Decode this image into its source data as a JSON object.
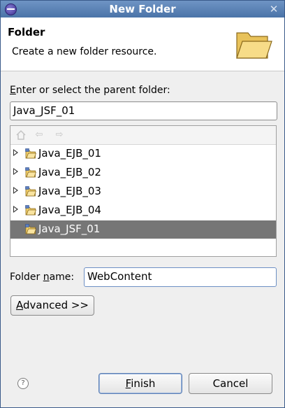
{
  "window": {
    "title": "New Folder"
  },
  "header": {
    "title": "Folder",
    "description": "Create a new folder resource."
  },
  "parent": {
    "label_mnemonic": "E",
    "label_rest": "nter or select the parent folder:",
    "value": "Java_JSF_01"
  },
  "tree": {
    "toolbar": {
      "home_icon": "home-icon",
      "back_icon": "back-arrow-icon",
      "forward_icon": "forward-arrow-icon"
    },
    "items": [
      {
        "label": "Java_EJB_01",
        "expandable": true,
        "selected": false
      },
      {
        "label": "Java_EJB_02",
        "expandable": true,
        "selected": false
      },
      {
        "label": "Java_EJB_03",
        "expandable": true,
        "selected": false
      },
      {
        "label": "Java_EJB_04",
        "expandable": true,
        "selected": false
      },
      {
        "label": "Java_JSF_01",
        "expandable": false,
        "selected": true
      }
    ]
  },
  "folder_name": {
    "label_before": "Folder ",
    "label_mnemonic": "n",
    "label_after": "ame:",
    "value": "WebContent"
  },
  "advanced": {
    "mnemonic": "A",
    "rest": "dvanced >>"
  },
  "buttons": {
    "finish": {
      "mnemonic": "F",
      "rest": "inish"
    },
    "cancel": "Cancel"
  },
  "help": {
    "symbol": "?"
  },
  "colors": {
    "titlebar": "#4a73a8",
    "selection": "#767676",
    "header_bg": "#ffffff",
    "dialog_bg": "#efefef"
  }
}
